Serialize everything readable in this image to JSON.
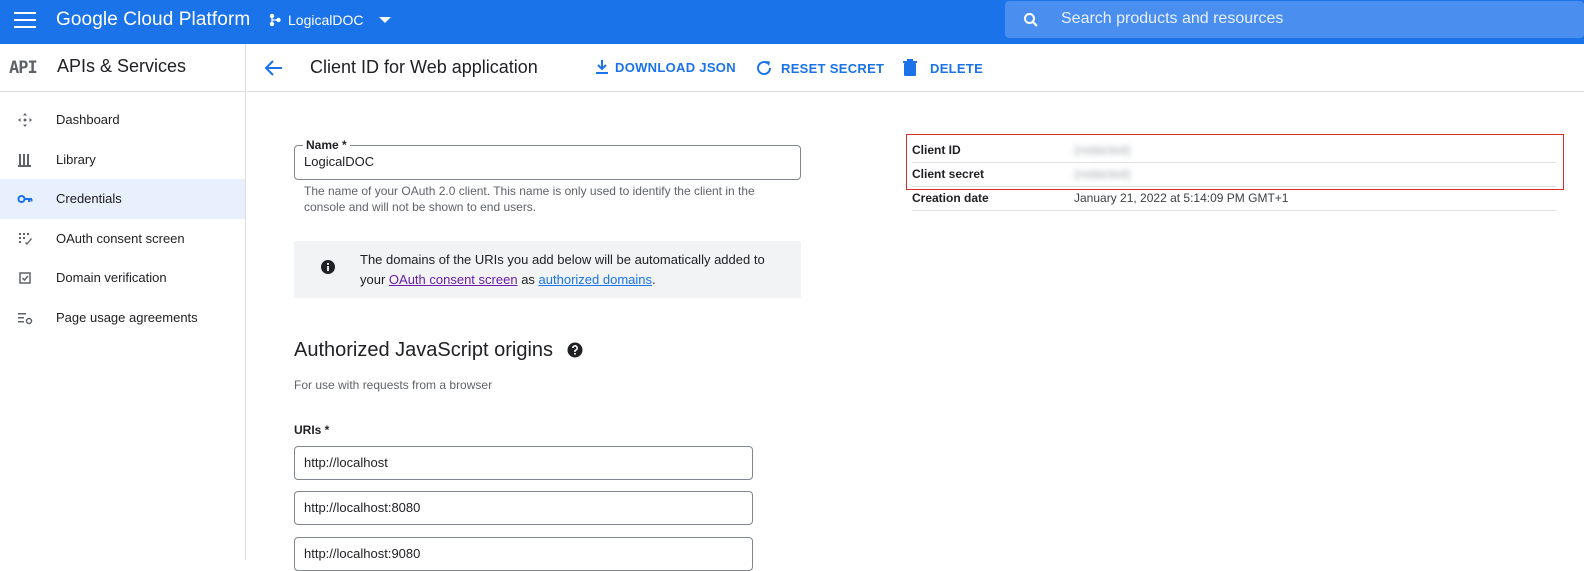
{
  "topbar": {
    "brand": "Google Cloud Platform",
    "project": "LogicalDOC",
    "search_placeholder": "Search products and resources"
  },
  "sidebar": {
    "logo": "API",
    "title": "APIs & Services",
    "items": [
      {
        "label": "Dashboard",
        "icon": "dashboard-icon"
      },
      {
        "label": "Library",
        "icon": "library-icon"
      },
      {
        "label": "Credentials",
        "icon": "key-icon",
        "active": true
      },
      {
        "label": "OAuth consent screen",
        "icon": "consent-icon"
      },
      {
        "label": "Domain verification",
        "icon": "check-box-icon"
      },
      {
        "label": "Page usage agreements",
        "icon": "settings-list-icon"
      }
    ]
  },
  "header": {
    "title": "Client ID for Web application",
    "actions": {
      "download": "DOWNLOAD JSON",
      "reset": "RESET SECRET",
      "delete": "DELETE"
    }
  },
  "form": {
    "name_label": "Name *",
    "name_value": "LogicalDOC",
    "name_hint": "The name of your OAuth 2.0 client. This name is only used to identify the client in the console and will not be shown to end users.",
    "info": {
      "before": "The domains of the URIs you add below will be automatically added to your",
      "link1": "OAuth consent screen",
      "middle": "as",
      "link2": "authorized domains",
      "after": "."
    },
    "origins_title": "Authorized JavaScript origins",
    "origins_sub": "For use with requests from a browser",
    "uris_label": "URIs *",
    "uris": [
      "http://localhost",
      "http://localhost:8080",
      "http://localhost:9080"
    ]
  },
  "details": {
    "client_id_label": "Client ID",
    "client_id_value": "(redacted)",
    "client_secret_label": "Client secret",
    "client_secret_value": "(redacted)",
    "creation_label": "Creation date",
    "creation_value": "January 21, 2022 at 5:14:09 PM GMT+1"
  },
  "colors": {
    "brand_blue": "#1a73e8",
    "highlight_red": "#d93025",
    "active_nav": "#e8f0fe"
  }
}
